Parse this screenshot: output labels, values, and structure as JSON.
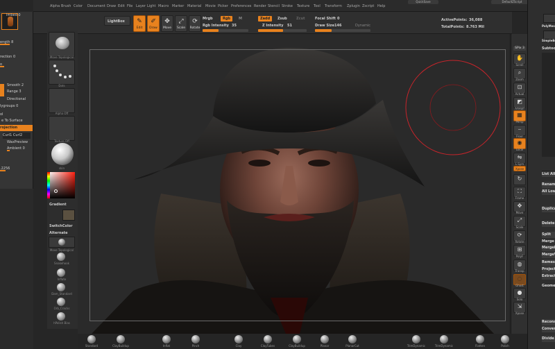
{
  "menu": {
    "items": [
      "Alpha",
      "Brush",
      "Color",
      "Document",
      "Draw",
      "Edit",
      "File",
      "Layer",
      "Light",
      "Macro",
      "Marker",
      "Material",
      "Movie",
      "Picker",
      "Preferences",
      "Render",
      "Stencil",
      "Stroke",
      "Texture",
      "Tool",
      "Transform",
      "Zplugin",
      "Zscript",
      "Help"
    ],
    "right_1": "QuickSave",
    "right_2": "DefaultZScript"
  },
  "toolbar": {
    "lightbox": "LightBox",
    "edit": "Edit",
    "draw": "Draw",
    "move": "Move",
    "scale": "Scale",
    "rotate": "Rotate",
    "mrgb": "Mrgb",
    "rgb": "Rgb",
    "m": "M",
    "rgb_intensity_label": "Rgb Intensity",
    "rgb_intensity": "35",
    "zadd": "Zadd",
    "zsub": "Zsub",
    "zcut": "Zcut",
    "z_intensity_label": "Z Intensity",
    "z_intensity": "51",
    "focal_shift_label": "Focal Shift",
    "focal_shift": "0",
    "draw_size_label": "Draw Size",
    "draw_size": "146",
    "dynamic": "Dynamic",
    "active_points_label": "ActivePoints:",
    "active_points": "36,088",
    "total_points_label": "TotalPoints:",
    "total_points": "8.763 Mil"
  },
  "left_panel": {
    "rows": [
      {
        "text": "Imbed 0"
      },
      {
        "text": "ength 8"
      },
      {
        "text": "rection 0"
      },
      {
        "text": "o"
      },
      {
        "text": "Smooth 2"
      },
      {
        "text": "Range 3"
      },
      {
        "text": "Directional"
      },
      {
        "text": "lygroups 0"
      },
      {
        "text": "ol"
      },
      {
        "text": "e To Surface"
      },
      {
        "text": "rojection"
      },
      {
        "text": "Curl1  Curl2"
      },
      {
        "text": "WaxPreview"
      },
      {
        "text": "Ambient 0"
      },
      {
        "text": ".2256"
      }
    ]
  },
  "shelf": {
    "thumb_captions": [
      "Move Topological",
      "Dots",
      "Alpha Off",
      "Texture Off",
      "skin"
    ],
    "gradient": "Gradient",
    "switch_color": "SwitchColor",
    "alternate": "Alternate",
    "brushes": [
      "Move Topological",
      "Snakehook",
      "Inflate",
      "Dam_Standard",
      "Orb_Cracks",
      "hPolish Bias"
    ]
  },
  "right_strip": {
    "top": "SPix 3",
    "buttons": [
      "Scroll",
      "Zoom",
      "Actual",
      "AAHalf",
      "Persp",
      "Floor",
      "Local",
      "L.Sym",
      "Xpose",
      "Frame",
      "Move",
      "Scale",
      "Rotate",
      "PolyF",
      "Transp",
      "Ghost",
      "Solo",
      "Xpose"
    ]
  },
  "right_panel": {
    "rows": [
      "PolyMesh3D",
      "SimpleBrush",
      "Subtool",
      "List All",
      "Rename",
      "All Low",
      "Duplicate",
      "Delete",
      "Split",
      "Merge",
      "MergeDown",
      "MergeVisible",
      "Remesh",
      "Project",
      "Extract",
      "Geometry",
      "Reconstruct",
      "Convert",
      "Divide"
    ]
  },
  "bottom_shelf": {
    "items": [
      "Standard",
      "ClayBuildup",
      "Inflat",
      "Pinch",
      "Clay",
      "ClayTubes",
      "ClayBuildup",
      "Planar",
      "PlanarCut",
      "TrimDynamic",
      "TrimDynamic",
      "Flatten",
      "Polish"
    ]
  },
  "colors": {
    "accent": "#e8821e",
    "panel": "#353535",
    "canvas": "#2a2a2a",
    "brush_cursor": "#c8242a"
  },
  "icons": {
    "edit": "pencil-icon",
    "draw": "brush-icon",
    "move": "move-arrows-icon",
    "scale": "scale-icon",
    "rotate": "rotate-icon"
  }
}
